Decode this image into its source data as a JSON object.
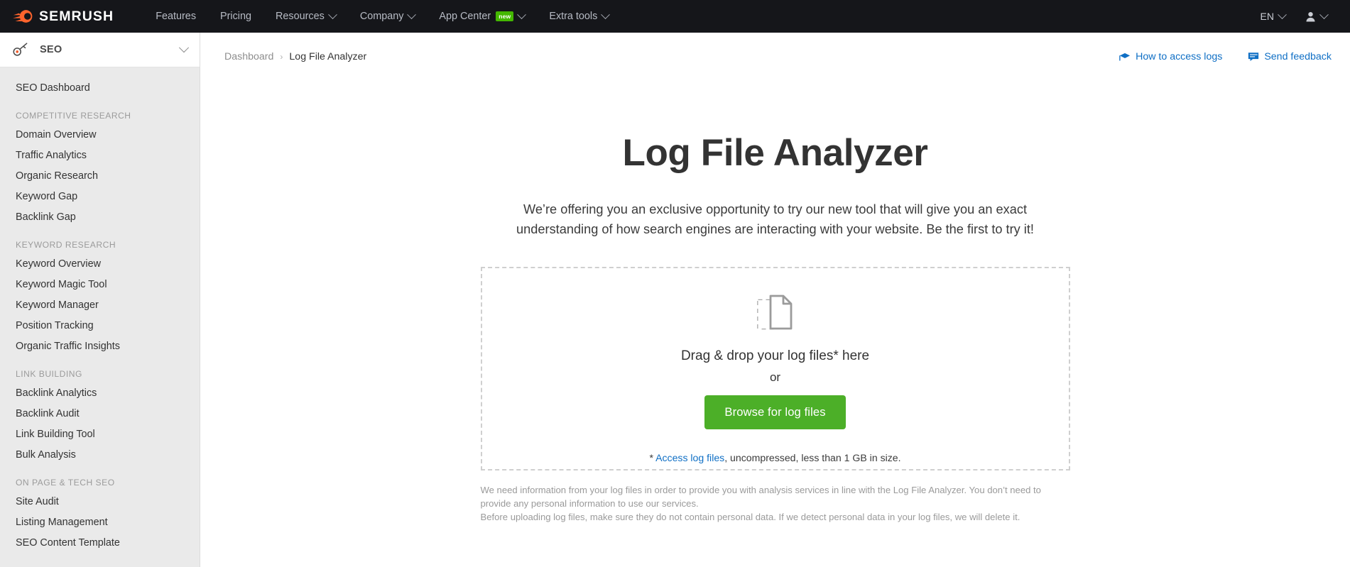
{
  "topnav": {
    "logo_text": "SEMRUSH",
    "logo_icon": "semrush-flame-icon",
    "items": [
      {
        "label": "Features",
        "has_caret": false,
        "badge": null
      },
      {
        "label": "Pricing",
        "has_caret": false,
        "badge": null
      },
      {
        "label": "Resources",
        "has_caret": true,
        "badge": null
      },
      {
        "label": "Company",
        "has_caret": true,
        "badge": null
      },
      {
        "label": "App Center",
        "has_caret": true,
        "badge": "new"
      },
      {
        "label": "Extra tools",
        "has_caret": true,
        "badge": null
      }
    ],
    "language": "EN",
    "account_icon": "user-avatar-icon"
  },
  "sidebar": {
    "header": {
      "label": "SEO",
      "icon": "key-icon",
      "chevron": "chevron-down-icon"
    },
    "entries": [
      {
        "type": "item",
        "label": "SEO Dashboard"
      },
      {
        "type": "group",
        "label": "COMPETITIVE RESEARCH"
      },
      {
        "type": "item",
        "label": "Domain Overview"
      },
      {
        "type": "item",
        "label": "Traffic Analytics"
      },
      {
        "type": "item",
        "label": "Organic Research"
      },
      {
        "type": "item",
        "label": "Keyword Gap"
      },
      {
        "type": "item",
        "label": "Backlink Gap"
      },
      {
        "type": "group",
        "label": "KEYWORD RESEARCH"
      },
      {
        "type": "item",
        "label": "Keyword Overview"
      },
      {
        "type": "item",
        "label": "Keyword Magic Tool"
      },
      {
        "type": "item",
        "label": "Keyword Manager"
      },
      {
        "type": "item",
        "label": "Position Tracking"
      },
      {
        "type": "item",
        "label": "Organic Traffic Insights"
      },
      {
        "type": "group",
        "label": "LINK BUILDING"
      },
      {
        "type": "item",
        "label": "Backlink Analytics"
      },
      {
        "type": "item",
        "label": "Backlink Audit"
      },
      {
        "type": "item",
        "label": "Link Building Tool"
      },
      {
        "type": "item",
        "label": "Bulk Analysis"
      },
      {
        "type": "group",
        "label": "ON PAGE & TECH SEO"
      },
      {
        "type": "item",
        "label": "Site Audit"
      },
      {
        "type": "item",
        "label": "Listing Management"
      },
      {
        "type": "item",
        "label": "SEO Content Template"
      }
    ]
  },
  "breadcrumb": {
    "root": "Dashboard",
    "separator": "›",
    "current": "Log File Analyzer"
  },
  "top_links": [
    {
      "label": "How to access logs",
      "icon": "graduation-cap-icon"
    },
    {
      "label": "Send feedback",
      "icon": "chat-bubble-icon"
    }
  ],
  "hero": {
    "title": "Log File Analyzer",
    "subtitle": "We’re offering you an exclusive opportunity to try our new tool that will give you an exact understanding of how search engines are interacting with your website. Be the first to try it!"
  },
  "dropzone": {
    "icon": "file-upload-icon",
    "drag_text": "Drag & drop your log files* here",
    "or_text": "or",
    "button_label": "Browse for log files",
    "note_prefix": "* ",
    "note_link": "Access log files",
    "note_suffix": ", uncompressed, less than 1 GB in size."
  },
  "disclaimer": {
    "line1": "We need information from your log files in order to provide you with analysis services in line with the Log File Analyzer. You don’t need to provide any personal information to use our services.",
    "line2": "Before uploading log files, make sure they do not contain personal data. If we detect personal data in your log files, we will delete it."
  },
  "colors": {
    "nav_bg": "#15161a",
    "sidebar_bg": "#eaeaea",
    "accent_green": "#4caf28",
    "link_blue": "#0f6fc5",
    "badge_green": "#44b700",
    "logo_orange": "#ff642d"
  }
}
